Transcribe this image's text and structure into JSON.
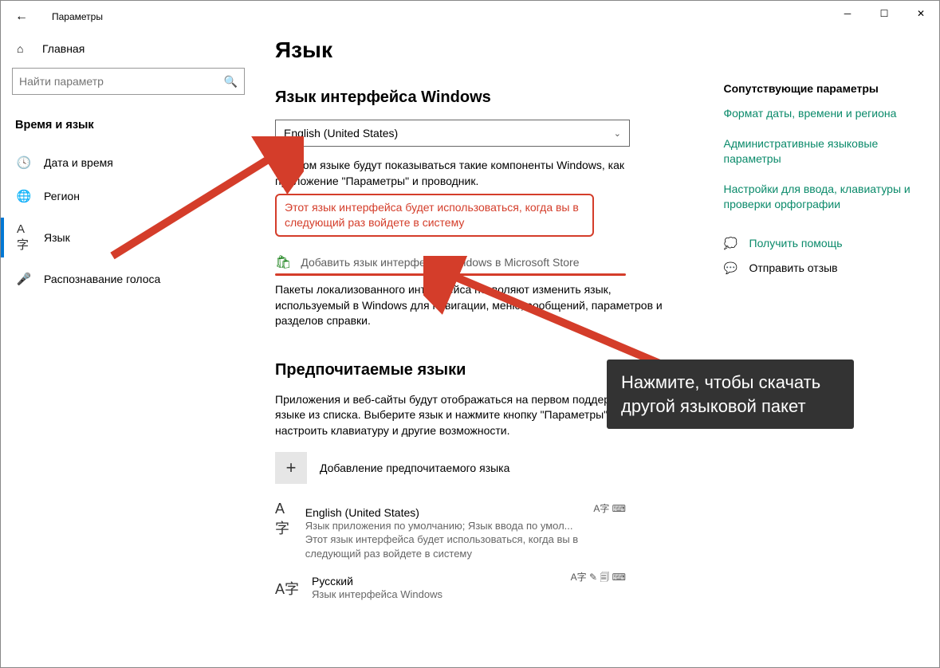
{
  "window": {
    "title": "Параметры"
  },
  "sidebar": {
    "home": "Главная",
    "search_placeholder": "Найти параметр",
    "category": "Время и язык",
    "items": [
      {
        "icon": "🕓",
        "label": "Дата и время"
      },
      {
        "icon": "🌐",
        "label": "Регион"
      },
      {
        "icon": "A字",
        "label": "Язык"
      },
      {
        "icon": "🎤",
        "label": "Распознавание голоса"
      }
    ]
  },
  "page": {
    "title": "Язык",
    "section1": {
      "heading": "Язык интерфейса Windows",
      "dropdown_value": "English (United States)",
      "description": "На этом языке будут показываться такие компоненты Windows, как приложение \"Параметры\" и проводник.",
      "highlight": "Этот язык интерфейса будет использоваться, когда вы в следующий раз войдете в систему",
      "store_link": "Добавить язык интерфейса Windows в Microsoft Store",
      "pack_desc": "Пакеты локализованного интерфейса позволяют изменить язык, используемый в Windows для навигации, меню, сообщений, параметров и разделов справки."
    },
    "section2": {
      "heading": "Предпочитаемые языки",
      "description": "Приложения и веб-сайты будут отображаться на первом поддерживаемом языке из списка. Выберите язык и нажмите кнопку \"Параметры\", чтобы настроить клавиатуру и другие возможности.",
      "add_label": "Добавление предпочитаемого языка",
      "langs": [
        {
          "name": "English (United States)",
          "sub": "Язык приложения по умолчанию; Язык ввода по умол...\nЭтот язык интерфейса будет использоваться, когда вы в следующий раз войдете в систему",
          "badges": "A字 ⌨"
        },
        {
          "name": "Русский",
          "sub": "Язык интерфейса Windows",
          "badges": "A字 ✎ 🗐 ⌨"
        }
      ]
    },
    "related": {
      "heading": "Сопутствующие параметры",
      "links": [
        "Формат даты, времени и региона",
        "Административные языковые параметры",
        "Настройки для ввода, клавиатуры и проверки орфографии"
      ],
      "help": "Получить помощь",
      "feedback": "Отправить отзыв"
    }
  },
  "annotation": {
    "callout": "Нажмите, чтобы скачать другой языковой пакет"
  }
}
